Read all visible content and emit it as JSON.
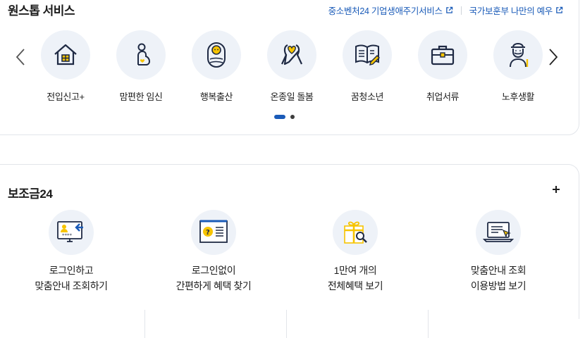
{
  "onestop": {
    "title": "원스톱 서비스",
    "links": [
      {
        "label": "중소벤처24 기업생애주기서비스",
        "icon": "external-link-icon"
      },
      {
        "label": "국가보훈부 나만의 예우",
        "icon": "external-link-icon"
      }
    ],
    "services": [
      {
        "label": "전입신고+",
        "icon": "house-icon"
      },
      {
        "label": "맘편한 임신",
        "icon": "pregnancy-icon"
      },
      {
        "label": "행복출산",
        "icon": "baby-icon"
      },
      {
        "label": "온종일 돌봄",
        "icon": "ribbon-heart-icon"
      },
      {
        "label": "꿈청소년",
        "icon": "book-pencil-icon"
      },
      {
        "label": "취업서류",
        "icon": "briefcase-icon"
      },
      {
        "label": "노후생활",
        "icon": "elderly-icon"
      }
    ],
    "pagination": {
      "active_page": 1,
      "total_pages": 2
    }
  },
  "subsidy": {
    "title": "보조금24",
    "items": [
      {
        "line1": "로그인하고",
        "line2": "맞춤안내 조회하기",
        "icon": "login-monitor-icon"
      },
      {
        "line1": "로그인없이",
        "line2": "간편하게 혜택 찾기",
        "icon": "question-document-icon"
      },
      {
        "line1": "1만여 개의",
        "line2": "전체혜택 보기",
        "icon": "gift-search-icon"
      },
      {
        "line1": "맞춤안내 조회",
        "line2": "이용방법 보기",
        "icon": "laptop-cursor-icon"
      }
    ]
  },
  "colors": {
    "accent": "#1a5bb8",
    "icon_yellow": "#f7c400",
    "circle_bg": "#eef2f8"
  }
}
